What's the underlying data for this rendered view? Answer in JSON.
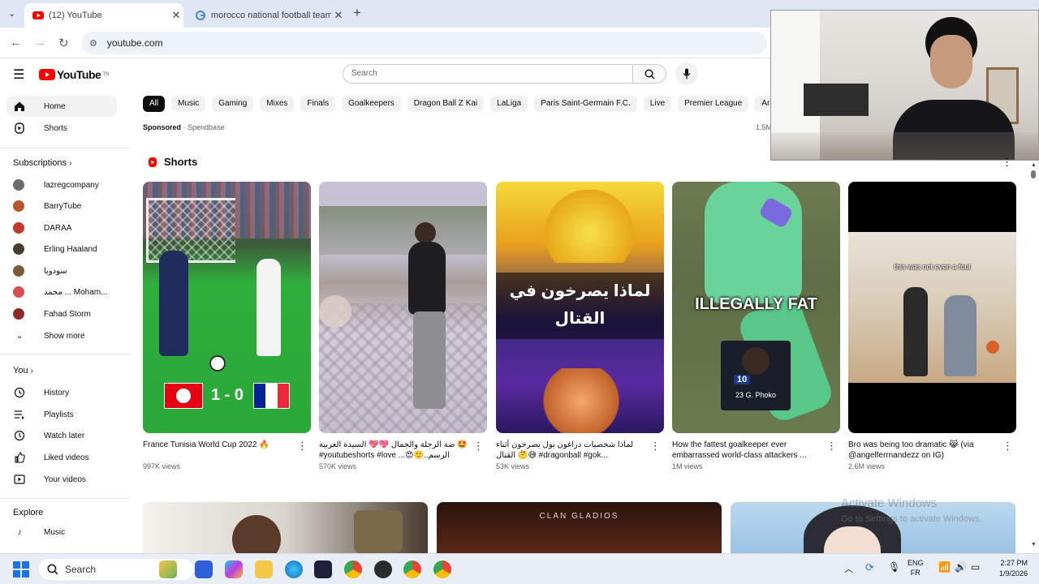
{
  "browser": {
    "tabs": [
      {
        "title": "(12) YouTube",
        "active": true
      },
      {
        "title": "morocco national football team",
        "active": false
      }
    ],
    "new_tab": "+",
    "url": "youtube.com"
  },
  "header": {
    "logo_text": "YouTube",
    "logo_sup": "TN",
    "search_placeholder": "Search"
  },
  "chips": [
    "All",
    "Music",
    "Gaming",
    "Mixes",
    "Finals",
    "Goalkeepers",
    "Dragon Ball Z Kai",
    "LaLiga",
    "Paris Saint-Germain F.C.",
    "Live",
    "Premier League",
    "Arabic M"
  ],
  "sidebar": {
    "main": [
      {
        "label": "Home",
        "icon": "home-icon"
      },
      {
        "label": "Shorts",
        "icon": "shorts-icon"
      }
    ],
    "subscriptions_title": "Subscriptions",
    "subscriptions": [
      {
        "label": "lazregcompany",
        "color": "#6b6b6b"
      },
      {
        "label": "BarryTube",
        "color": "#b5562e"
      },
      {
        "label": "DARAA",
        "color": "#c0392b"
      },
      {
        "label": "Erling Haaland",
        "color": "#4a3b2f"
      },
      {
        "label": "سودويا",
        "color": "#7a5c3a"
      },
      {
        "label": "محمد ... Moham...",
        "color": "#d94f4f"
      },
      {
        "label": "Fahad Storm",
        "color": "#8e2a2a"
      }
    ],
    "show_more": "Show more",
    "you_title": "You",
    "you_items": [
      {
        "label": "History",
        "icon": "history-icon"
      },
      {
        "label": "Playlists",
        "icon": "playlists-icon"
      },
      {
        "label": "Watch later",
        "icon": "watch-later-icon"
      },
      {
        "label": "Liked videos",
        "icon": "liked-videos-icon"
      },
      {
        "label": "Your videos",
        "icon": "your-videos-icon"
      }
    ],
    "explore_title": "Explore",
    "explore_items": [
      {
        "label": "Music",
        "icon": "music-icon"
      }
    ]
  },
  "main": {
    "sponsored_label": "Sponsored",
    "sponsored_by": "· Spendbase",
    "sponsored_right": "1.5M",
    "shorts_title": "Shorts",
    "shorts": [
      {
        "title": "France Tunisia World Cup 2022 🔥",
        "views": "997K views",
        "overlay": "1 - 0"
      },
      {
        "title": "ضة الرجلة والجمال 💖💖 السيدة العربية 🤩 #youtubeshorts #love ...😍🙂..الرسم",
        "views": "570K views",
        "overlay": ""
      },
      {
        "title": "لماذا شخصيات دراغون بول يصرخون أثناء القتال 🤔😅 #dragonball #gok...",
        "views": "53K views",
        "overlay": "لماذا يصرخون في القتال"
      },
      {
        "title": "How the fattest goalkeeper ever embarrassed world-class attackers ...",
        "views": "1M views",
        "overlay": "ILLEGALLY FAT",
        "card_number": "10",
        "card_name": "23 G. Phoko"
      },
      {
        "title": "Bro was being too dramatic 😹 (via @angelferrnandezz on IG)",
        "views": "2.6M views",
        "overlay": "this was not even a foul"
      }
    ],
    "video_row_text": "CLAN GLADIOS"
  },
  "watermark": {
    "line1": "Activate Windows",
    "line2": "Go to Settings to activate Windows."
  },
  "taskbar": {
    "search_label": "Search",
    "lang_top": "ENG",
    "lang_bottom": "FR",
    "time": "2:27 PM",
    "date": "1/9/2026"
  },
  "colors": {
    "yt_red": "#ff0000",
    "chip_bg": "#f2f2f2",
    "chip_active": "#0f0f0f",
    "tabbar_bg": "#dfe7f4"
  }
}
